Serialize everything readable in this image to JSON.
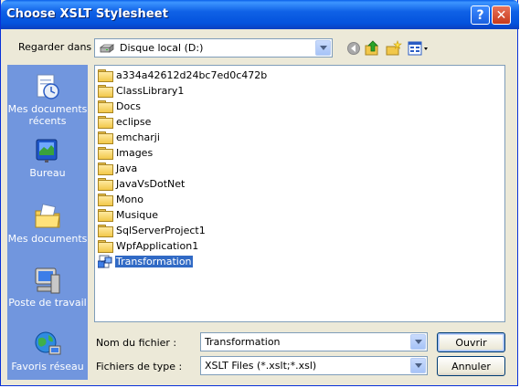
{
  "window": {
    "title": "Choose XSLT Stylesheet",
    "help_label": "?",
    "close_label": "✕"
  },
  "look_in": {
    "label": "Regarder dans :",
    "value": "Disque local (D:)"
  },
  "places": [
    {
      "label": "Mes documents récents",
      "icon": "recent-documents-icon"
    },
    {
      "label": "Bureau",
      "icon": "desktop-icon"
    },
    {
      "label": "Mes documents",
      "icon": "my-documents-icon"
    },
    {
      "label": "Poste de travail",
      "icon": "my-computer-icon"
    },
    {
      "label": "Favoris réseau",
      "icon": "network-places-icon"
    }
  ],
  "files": [
    {
      "name": "a334a42612d24bc7ed0c472b",
      "type": "folder"
    },
    {
      "name": "ClassLibrary1",
      "type": "folder"
    },
    {
      "name": "Docs",
      "type": "folder"
    },
    {
      "name": "eclipse",
      "type": "folder"
    },
    {
      "name": "emcharji",
      "type": "folder"
    },
    {
      "name": "Images",
      "type": "folder"
    },
    {
      "name": "Java",
      "type": "folder"
    },
    {
      "name": "JavaVsDotNet",
      "type": "folder"
    },
    {
      "name": "Mono",
      "type": "folder"
    },
    {
      "name": "Musique",
      "type": "folder"
    },
    {
      "name": "SqlServerProject1",
      "type": "folder"
    },
    {
      "name": "WpfApplication1",
      "type": "folder"
    },
    {
      "name": "Transformation",
      "type": "xslt-file",
      "selected": true
    }
  ],
  "filename": {
    "label": "Nom du fichier :",
    "value": "Transformation"
  },
  "filetype": {
    "label": "Fichiers de type :",
    "value": "XSLT Files (*.xslt;*.xsl)"
  },
  "buttons": {
    "open": "Ouvrir",
    "cancel": "Annuler"
  },
  "colors": {
    "titlebar": "#0453dd",
    "places_bar": "#7196de",
    "selection": "#316ac5",
    "dialog_bg": "#ece9d8"
  }
}
